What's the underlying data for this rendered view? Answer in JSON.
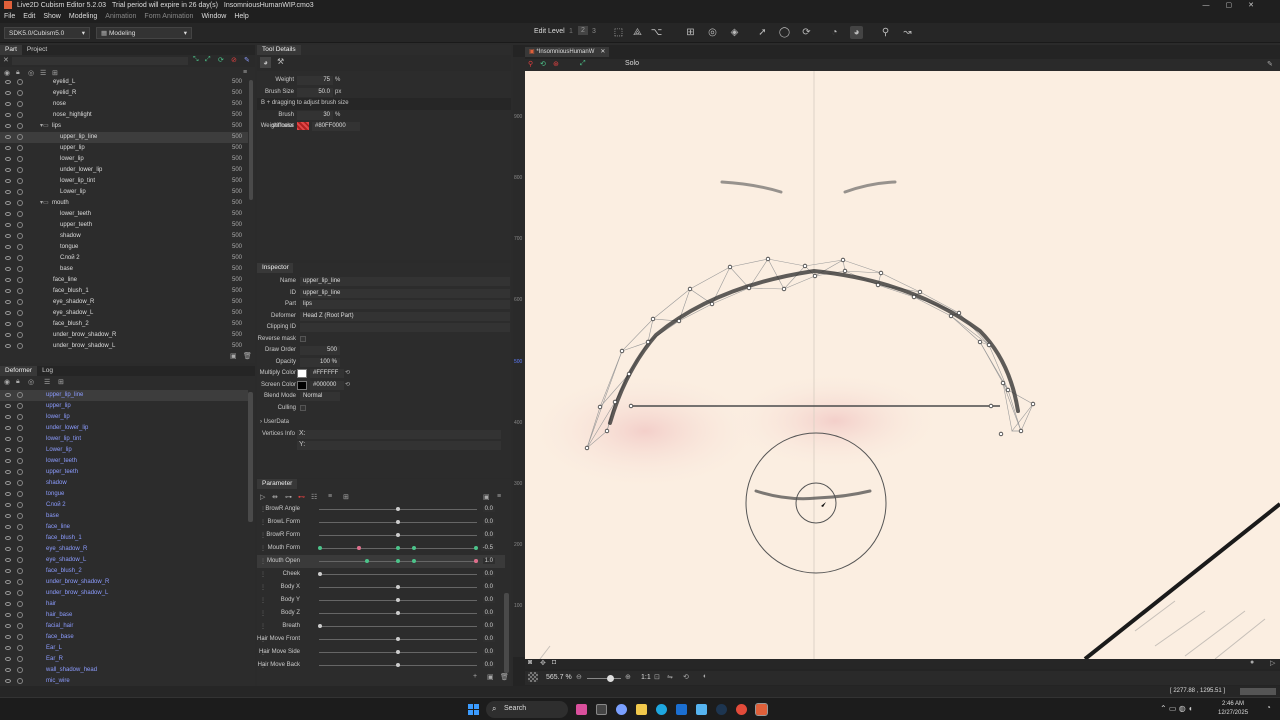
{
  "app": {
    "title": "Live2D Cubism Editor 5.2.03",
    "trial": "Trial period will expire in 26 day(s)",
    "file": "InsomniousHumanWIP.cmo3"
  },
  "menu": [
    "File",
    "Edit",
    "Show",
    "Modeling",
    "Animation",
    "Form Animation",
    "Window",
    "Help"
  ],
  "toolbar": {
    "sdk": "SDK5.0/Cubism5.0",
    "mode": "Modeling",
    "edit_level": "Edit Level",
    "levels": [
      "1",
      "2",
      "3"
    ]
  },
  "part_panel": {
    "tabs": [
      "Part",
      "Project"
    ],
    "items": [
      {
        "name": "eyelid_L",
        "num": "500",
        "indent": 1
      },
      {
        "name": "eyelid_R",
        "num": "500",
        "indent": 1
      },
      {
        "name": "nose",
        "num": "500",
        "indent": 1
      },
      {
        "name": "nose_highlight",
        "num": "500",
        "indent": 1
      },
      {
        "name": "lips",
        "num": "500",
        "indent": 0
      },
      {
        "name": "upper_lip_line",
        "num": "500",
        "indent": 2
      },
      {
        "name": "upper_lip",
        "num": "500",
        "indent": 2
      },
      {
        "name": "lower_lip",
        "num": "500",
        "indent": 2
      },
      {
        "name": "under_lower_lip",
        "num": "500",
        "indent": 2
      },
      {
        "name": "lower_lip_tint",
        "num": "500",
        "indent": 2
      },
      {
        "name": "Lower_lip",
        "num": "500",
        "indent": 2
      },
      {
        "name": "mouth",
        "num": "500",
        "indent": 0
      },
      {
        "name": "lower_teeth",
        "num": "500",
        "indent": 2
      },
      {
        "name": "upper_teeth",
        "num": "500",
        "indent": 2
      },
      {
        "name": "shadow",
        "num": "500",
        "indent": 2
      },
      {
        "name": "tongue",
        "num": "500",
        "indent": 2
      },
      {
        "name": "Слой 2",
        "num": "500",
        "indent": 2
      },
      {
        "name": "base",
        "num": "500",
        "indent": 2
      },
      {
        "name": "face_line",
        "num": "500",
        "indent": 1
      },
      {
        "name": "face_blush_1",
        "num": "500",
        "indent": 1
      },
      {
        "name": "eye_shadow_R",
        "num": "500",
        "indent": 1
      },
      {
        "name": "eye_shadow_L",
        "num": "500",
        "indent": 1
      },
      {
        "name": "face_blush_2",
        "num": "500",
        "indent": 1
      },
      {
        "name": "under_brow_shadow_R",
        "num": "500",
        "indent": 1
      },
      {
        "name": "under_brow_shadow_L",
        "num": "500",
        "indent": 1
      }
    ]
  },
  "deformer_panel": {
    "tabs": [
      "Deformer",
      "Log"
    ],
    "items": [
      "upper_lip_line",
      "upper_lip",
      "lower_lip",
      "under_lower_lip",
      "lower_lip_tint",
      "Lower_lip",
      "lower_teeth",
      "upper_teeth",
      "shadow",
      "tongue",
      "Слой 2",
      "base",
      "face_line",
      "face_blush_1",
      "eye_shadow_R",
      "eye_shadow_L",
      "face_blush_2",
      "under_brow_shadow_R",
      "under_brow_shadow_L",
      "hair",
      "hair_base",
      "facial_hair",
      "face_base",
      "Ear_L",
      "Ear_R",
      "wall_shadow_head",
      "mic_wire"
    ]
  },
  "tool_details": {
    "title": "Tool Details",
    "weight_label": "Weight",
    "weight": "75",
    "weight_unit": "%",
    "brush_label": "Brush Size",
    "brush": "50.0",
    "brush_unit": "px",
    "hint": "B + dragging to adjust brush size",
    "stiff_label": "Brush stiffness",
    "stiff": "30",
    "stiff_unit": "%",
    "color_label": "Weight color",
    "color": "#80FF0000"
  },
  "inspector": {
    "title": "Inspector",
    "rows": [
      {
        "k": "Name",
        "v": "upper_lip_line"
      },
      {
        "k": "ID",
        "v": "upper_lip_line"
      },
      {
        "k": "Part",
        "v": "lips"
      },
      {
        "k": "Deformer",
        "v": "Head Z (Root Part)"
      },
      {
        "k": "Clipping ID",
        "v": ""
      },
      {
        "k": "Reverse mask",
        "v": ""
      },
      {
        "k": "Draw Order",
        "v": "500"
      },
      {
        "k": "Opacity",
        "v": "100 %"
      },
      {
        "k": "Multiply Color",
        "v": "#FFFFFF"
      },
      {
        "k": "Screen Color",
        "v": "#000000"
      },
      {
        "k": "Blend Mode",
        "v": "Normal"
      },
      {
        "k": "Culling",
        "v": ""
      }
    ],
    "userdata": "UserData",
    "vertices": "Vertices Info",
    "vx": "X:",
    "vy": "Y:"
  },
  "parameter": {
    "title": "Parameter",
    "rows": [
      {
        "name": "BrowR Angle",
        "value": "0.0",
        "pos": 0.5,
        "keys": []
      },
      {
        "name": "BrowL Form",
        "value": "0.0",
        "pos": 0.5,
        "keys": []
      },
      {
        "name": "BrowR Form",
        "value": "0.0",
        "pos": 0.5,
        "keys": []
      },
      {
        "name": "Mouth Form",
        "value": "-0.5",
        "pos": 0.25,
        "keys": [
          0,
          0.25,
          0.5,
          0.6,
          1
        ]
      },
      {
        "name": "Mouth Open",
        "value": "1.0",
        "pos": 1,
        "keys": [
          0.3,
          0.5,
          0.6,
          1
        ]
      },
      {
        "name": "Cheek",
        "value": "0.0",
        "pos": 0,
        "keys": []
      },
      {
        "name": "Body X",
        "value": "0.0",
        "pos": 0.5,
        "keys": []
      },
      {
        "name": "Body Y",
        "value": "0.0",
        "pos": 0.5,
        "keys": []
      },
      {
        "name": "Body Z",
        "value": "0.0",
        "pos": 0.5,
        "keys": []
      },
      {
        "name": "Breath",
        "value": "0.0",
        "pos": 0,
        "keys": []
      },
      {
        "name": "Hair Move Front",
        "value": "0.0",
        "pos": 0.5,
        "keys": []
      },
      {
        "name": "Hair Move Side",
        "value": "0.0",
        "pos": 0.5,
        "keys": []
      },
      {
        "name": "Hair Move Back",
        "value": "0.0",
        "pos": 0.5,
        "keys": []
      }
    ]
  },
  "viewport": {
    "tab": "*InsomniousHumanW",
    "solo": "Solo",
    "zoom": "565.7 %",
    "ratio": "1:1",
    "coords": "[ 2277.88 , 1295.51 ]",
    "ruler": [
      "900",
      "800",
      "700",
      "600",
      "500",
      "400",
      "300",
      "200",
      "100"
    ]
  },
  "taskbar": {
    "search": "Search",
    "time": "2:46 AM",
    "date": "12/27/2025"
  }
}
